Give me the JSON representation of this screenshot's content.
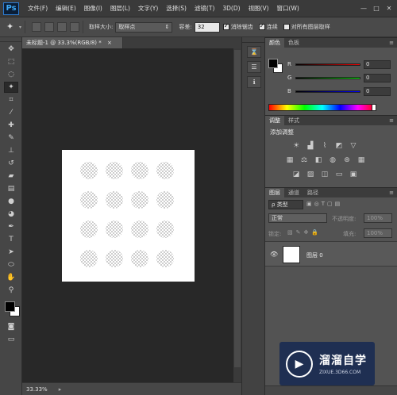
{
  "app": {
    "logo": "Ps"
  },
  "menu": [
    "文件(F)",
    "编辑(E)",
    "图像(I)",
    "图层(L)",
    "文字(Y)",
    "选择(S)",
    "滤镜(T)",
    "3D(D)",
    "视图(V)",
    "窗口(W)"
  ],
  "window_controls": [
    "—",
    "□",
    "✕"
  ],
  "options": {
    "sample_size_label": "取样大小:",
    "sample_size_value": "取样点",
    "tolerance_label": "容差:",
    "tolerance_value": "32",
    "antialias_label": "消除锯齿",
    "contiguous_label": "连续",
    "all_layers_label": "对所有图层取样",
    "antialias_checked": true,
    "contiguous_checked": true,
    "all_layers_checked": false
  },
  "document": {
    "tab_title": "未标题-1 @ 33.3%(RGB/8) *",
    "tab_close": "×",
    "zoom": "33.33%",
    "circle_grid_rows": 4,
    "circle_grid_cols": 4
  },
  "color_panel": {
    "tabs": [
      "颜色",
      "色板"
    ],
    "channels": [
      {
        "label": "R",
        "value": "0"
      },
      {
        "label": "G",
        "value": "0"
      },
      {
        "label": "B",
        "value": "0"
      }
    ],
    "foreground": "#000000",
    "background": "#ffffff"
  },
  "adjust_panel": {
    "tabs": [
      "调整",
      "样式"
    ],
    "header": "添加调整"
  },
  "layers_panel": {
    "tabs": [
      "图层",
      "通道",
      "路径"
    ],
    "filter_label": "类型",
    "blend_mode": "正常",
    "opacity_label": "不透明度:",
    "opacity_value": "100%",
    "lock_label": "锁定:",
    "fill_label": "填充:",
    "fill_value": "100%",
    "layers": [
      {
        "name": "图层 0"
      }
    ]
  },
  "watermark": {
    "title": "溜溜自学",
    "url": "ZIXUE.3D66.COM"
  }
}
